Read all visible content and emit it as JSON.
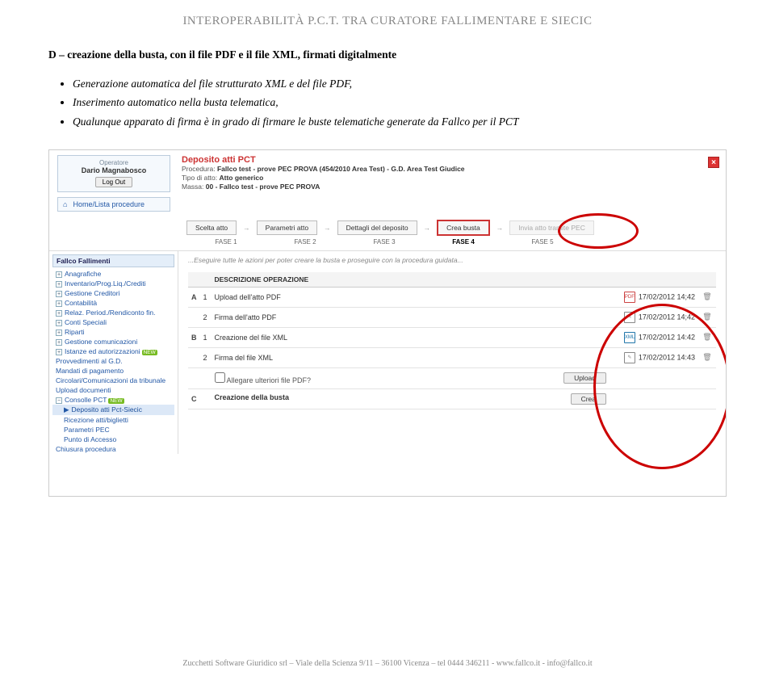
{
  "header": "INTEROPERABILITÀ P.C.T. TRA CURATORE FALLIMENTARE E SIECIC",
  "section_title": "D – creazione della busta, con il file PDF e il file XML, firmati digitalmente",
  "bullets": [
    "Generazione automatica del file strutturato XML e del file PDF,",
    "Inserimento automatico nella busta telematica,",
    "Qualunque apparato di firma è in grado di firmare le buste telematiche generate da Fallco per il PCT"
  ],
  "screenshot": {
    "operator_label": "Operatore",
    "operator_name": "Dario Magnabosco",
    "logout": "Log Out",
    "deposit_title": "Deposito atti PCT",
    "meta": {
      "procedura_l": "Procedura:",
      "procedura_v": "Fallco test - prove PEC PROVA (454/2010 Area Test) - G.D. Area Test Giudice",
      "tipo_l": "Tipo di atto:",
      "tipo_v": "Atto generico",
      "massa_l": "Massa:",
      "massa_v": "00 - Fallco test - prove PEC PROVA"
    },
    "home_link": "Home/Lista procedure",
    "wizard": {
      "steps": [
        "Scelta atto",
        "Parametri atto",
        "Dettagli del deposito",
        "Crea busta",
        "Invia atto tramite PEC"
      ],
      "phases": [
        "FASE 1",
        "FASE 2",
        "FASE 3",
        "FASE 4",
        "FASE 5"
      ]
    },
    "hint": "...Eseguire tutte le azioni per poter creare la busta e proseguire con la procedura guidata...",
    "sidebar_title": "Fallco Fallimenti",
    "sidebar": [
      {
        "t": "Anagrafiche"
      },
      {
        "t": "Inventario/Prog.Liq./Crediti"
      },
      {
        "t": "Gestione Creditori"
      },
      {
        "t": "Contabilità"
      },
      {
        "t": "Relaz. Period./Rendiconto fin."
      },
      {
        "t": "Conti Speciali"
      },
      {
        "t": "Riparti"
      },
      {
        "t": "Gestione comunicazioni"
      },
      {
        "t": "Istanze ed autorizzazioni",
        "new": true
      },
      {
        "t": "Provvedimenti al G.D.",
        "plain": true
      },
      {
        "t": "Mandati di pagamento",
        "plain": true
      },
      {
        "t": "Circolari/Comunicazioni da tribunale",
        "plain": true
      },
      {
        "t": "Upload documenti",
        "plain": true
      },
      {
        "t": "Consolle PCT",
        "new": true,
        "open": true
      },
      {
        "t": "Deposito atti Pct-Siecic",
        "sub": true,
        "active": true
      },
      {
        "t": "Ricezione atti/biglietti",
        "sub": true
      },
      {
        "t": "Parametri PEC",
        "sub": true
      },
      {
        "t": "Punto di Accesso",
        "sub": true
      },
      {
        "t": "Chiusura procedura",
        "plain": true
      }
    ],
    "table": {
      "header": "DESCRIZIONE OPERAZIONE",
      "rows": [
        {
          "grp": "A",
          "n": "1",
          "desc": "Upload dell'atto PDF",
          "icon": "pdf",
          "date": "17/02/2012 14;42",
          "trash": true
        },
        {
          "grp": "",
          "n": "2",
          "desc": "Firma dell'atto PDF",
          "icon": "sig",
          "date": "17/02/2012 14;42",
          "trash": true
        },
        {
          "grp": "B",
          "n": "1",
          "desc": "Creazione del file XML",
          "icon": "xml",
          "date": "17/02/2012 14:42",
          "trash": true
        },
        {
          "grp": "",
          "n": "2",
          "desc": "Firma del file XML",
          "icon": "sig",
          "date": "17/02/2012 14:43",
          "trash": true
        }
      ],
      "allega_label": "Allegare ulteriori file PDF?",
      "allega_btn": "Upload",
      "crea_label": "Creazione della busta",
      "crea_btn": "Crea",
      "grp_c": "C"
    }
  },
  "footer": "Zucchetti Software Giuridico srl – Viale della Scienza 9/11 – 36100 Vicenza – tel 0444 346211 - www.fallco.it  - info@fallco.it"
}
